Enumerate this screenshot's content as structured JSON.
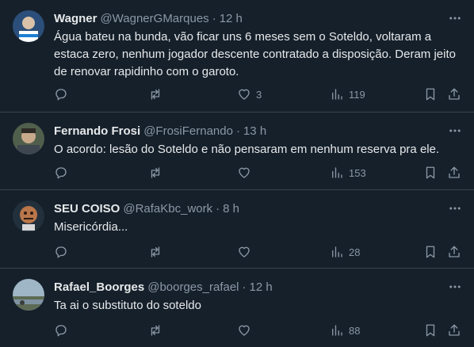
{
  "tweets": [
    {
      "name": "Wagner",
      "handle": "@WagnerGMarques",
      "time": "12 h",
      "text": "Água bateu na bunda, vão ficar uns 6 meses sem o Soteldo, voltaram a estaca zero, nenhum jogador descente contratado a disposição. Deram jeito de renovar rapidinho com o garoto.",
      "likes": "3",
      "views": "119",
      "avatar_color": "#3a6fb0"
    },
    {
      "name": "Fernando Frosi",
      "handle": "@FrosiFernando",
      "time": "13 h",
      "text": "O acordo: lesão do Soteldo e não pensaram em nenhum reserva pra ele.",
      "likes": "",
      "views": "153",
      "avatar_color": "#6b7d6a"
    },
    {
      "name": "SEU COISO",
      "handle": "@RafaKbc_work",
      "time": "8 h",
      "text": "Misericórdia...",
      "likes": "",
      "views": "28",
      "avatar_color": "#c0825a"
    },
    {
      "name": "Rafael_Boorges",
      "handle": "@boorges_rafael",
      "time": "12 h",
      "text": "Ta ai o substituto do soteldo",
      "likes": "",
      "views": "88",
      "avatar_color": "#8fa7b8"
    }
  ],
  "dot_separator": "·",
  "colors": {
    "background": "#15202b",
    "border": "#38444d",
    "muted": "#8b98a5",
    "text": "#e7e9ea"
  }
}
